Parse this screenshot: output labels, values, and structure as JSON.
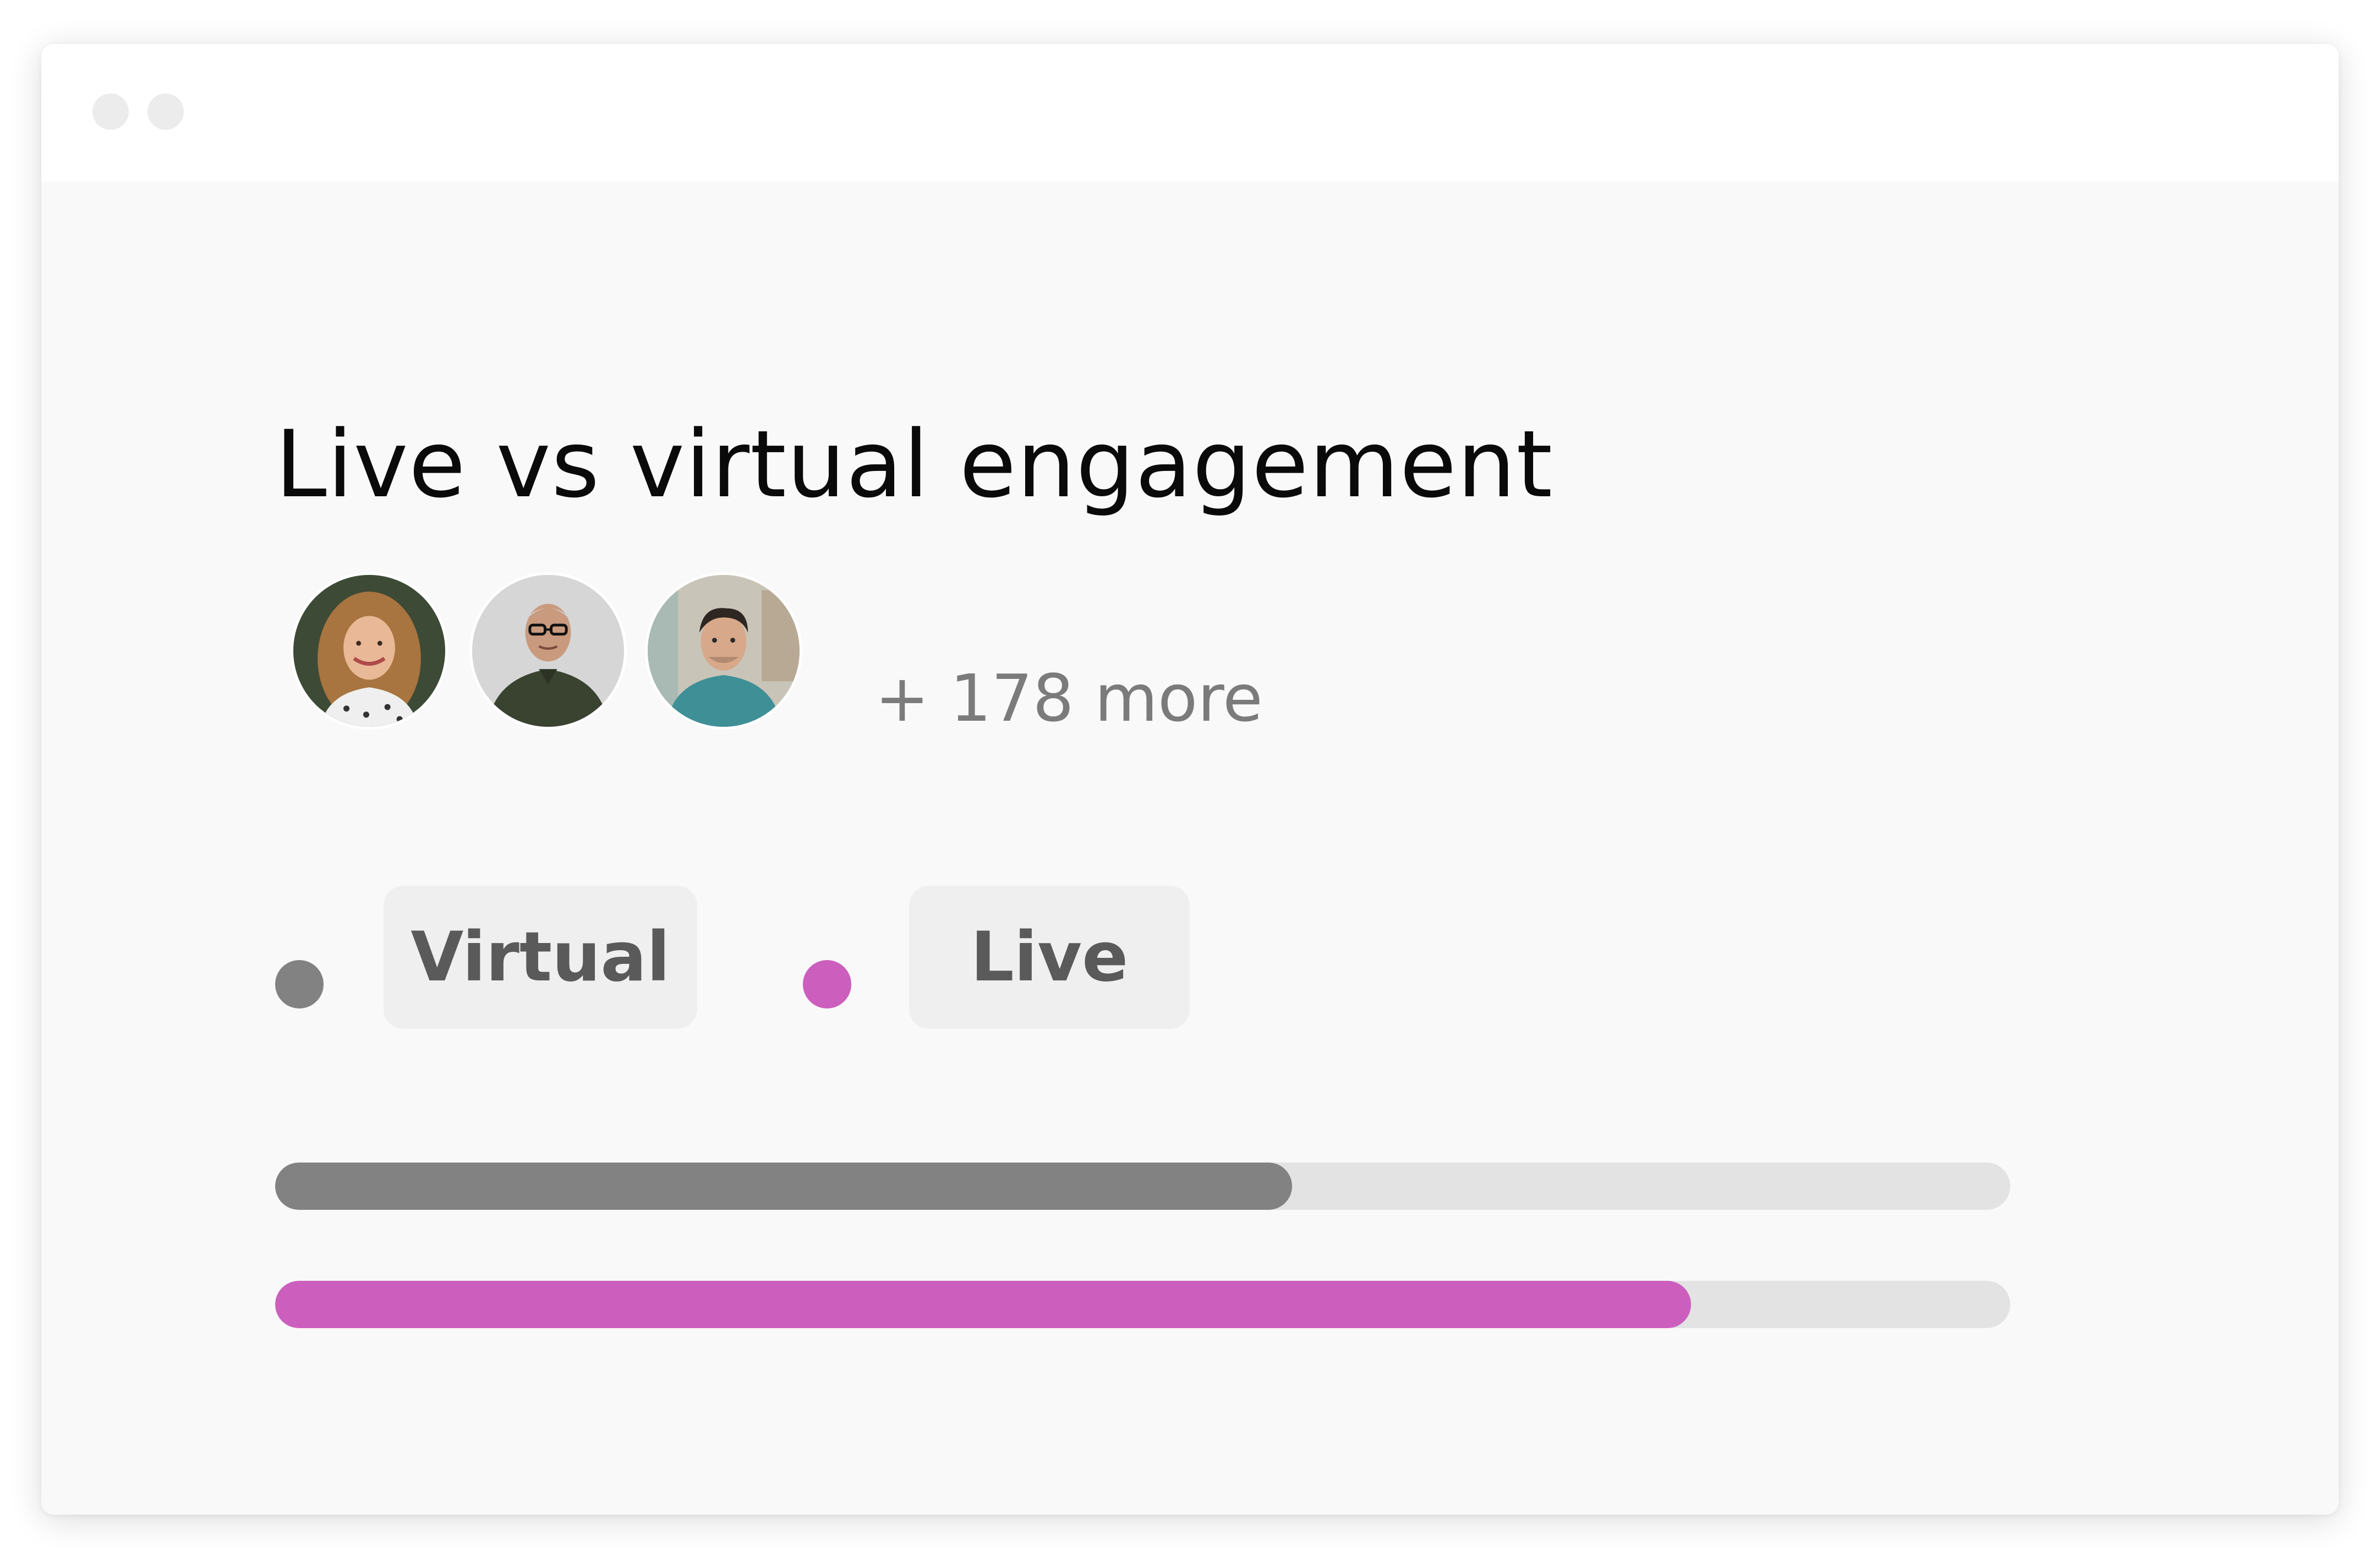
{
  "title": "Live vs virtual engagement",
  "attendees": {
    "avatars": [
      {
        "name": "avatar-woman"
      },
      {
        "name": "avatar-man-glasses"
      },
      {
        "name": "avatar-young-man"
      }
    ],
    "more_label": "+ 178 more"
  },
  "legend": {
    "virtual_label": "Virtual",
    "live_label": "Live",
    "virtual_color": "#828282",
    "live_color": "#cc5fbe"
  },
  "bars": [
    {
      "label": "Virtual",
      "fraction": 0.586,
      "color": "#828282"
    },
    {
      "label": "Live",
      "fraction": 0.816,
      "color": "#cc5fbe"
    }
  ],
  "colors": {
    "track": "#e3e3e3",
    "window_bg": "#f9f9f9",
    "titlebar_bg": "#ffffff"
  }
}
